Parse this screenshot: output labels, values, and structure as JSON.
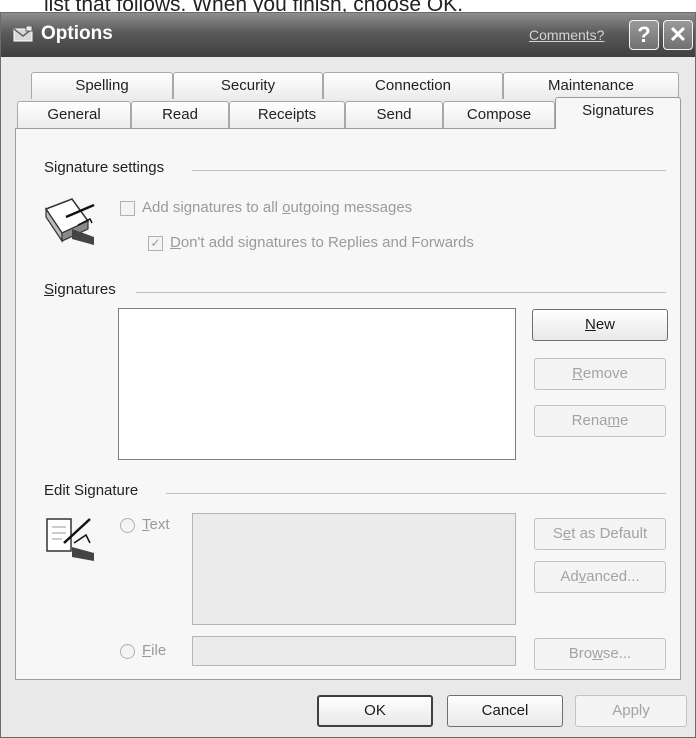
{
  "caption_text": "list that follows. When you finish, choose OK.",
  "window": {
    "title": "Options",
    "comments_link": "Comments?",
    "help_glyph": "?",
    "close_glyph": "✕"
  },
  "tabs_back": [
    "Spelling",
    "Security",
    "Connection",
    "Maintenance"
  ],
  "tabs_front": [
    "General",
    "Read",
    "Receipts",
    "Send",
    "Compose",
    "Signatures"
  ],
  "active_tab": "Signatures",
  "signature_settings": {
    "heading": "Signature settings",
    "add_all_pre": "Add signatures to all ",
    "add_all_accel": "o",
    "add_all_post": "utgoing messages",
    "add_all_checked": false,
    "dont_add_accel": "D",
    "dont_add_post": "on't add signatures to Replies and Forwards",
    "dont_add_checked": true,
    "check_glyph": "✓"
  },
  "signatures": {
    "heading_accel": "S",
    "heading_post": "ignatures",
    "new_accel": "N",
    "new_post": "ew",
    "remove_accel": "R",
    "remove_post": "emove",
    "rename_pre": "Rena",
    "rename_accel": "m",
    "rename_post": "e"
  },
  "edit_signature": {
    "heading": "Edit Signature",
    "text_accel": "T",
    "text_post": "ext",
    "file_accel": "F",
    "file_post": "ile",
    "set_default_pre": "S",
    "set_default_accel": "e",
    "set_default_post": "t as Default",
    "advanced_pre": "Ad",
    "advanced_accel": "v",
    "advanced_post": "anced...",
    "browse_pre": "Bro",
    "browse_accel": "w",
    "browse_post": "se..."
  },
  "footer": {
    "ok": "OK",
    "cancel": "Cancel",
    "apply": "Apply"
  }
}
